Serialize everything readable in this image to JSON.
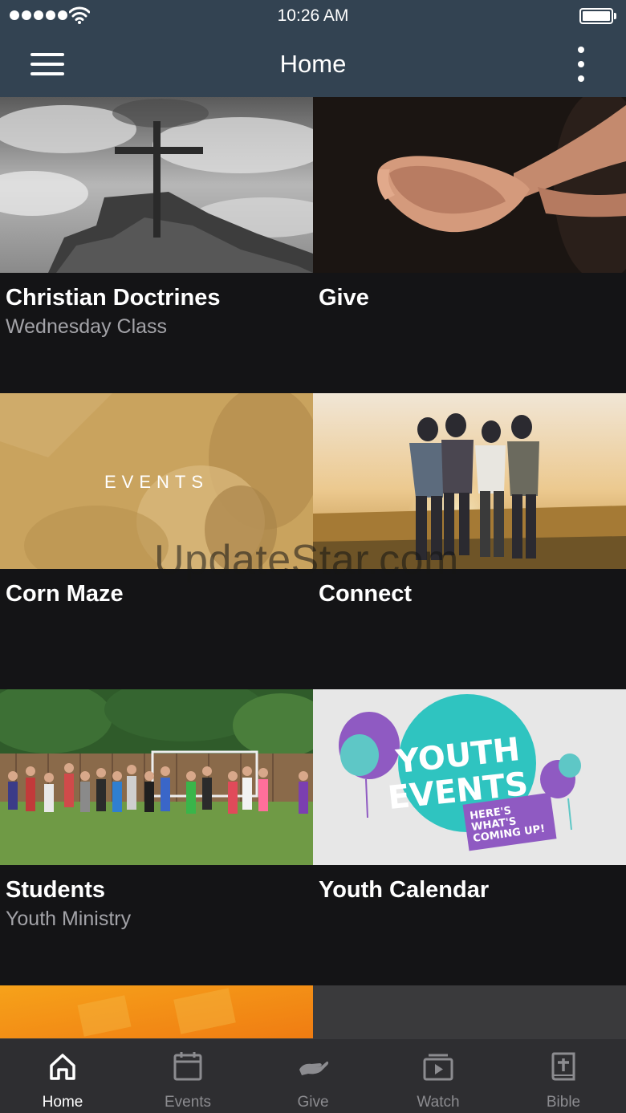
{
  "status_bar": {
    "time": "10:26 AM",
    "signal_icon": "signal-dots-icon",
    "wifi_icon": "wifi-icon",
    "battery_icon": "battery-icon"
  },
  "nav": {
    "title": "Home",
    "menu_icon": "hamburger-menu-icon",
    "more_icon": "more-vertical-icon"
  },
  "tiles": [
    {
      "title": "Christian Doctrines",
      "subtitle": "Wednesday Class",
      "image": "cross-on-rocks-photo"
    },
    {
      "title": "Give",
      "subtitle": "",
      "image": "open-hands-photo"
    },
    {
      "title": "Corn Maze",
      "subtitle": "",
      "image": "events-banner-photo",
      "image_text": "EVENTS"
    },
    {
      "title": "Connect",
      "subtitle": "",
      "image": "friends-sunset-photo"
    },
    {
      "title": "Students",
      "subtitle": "Youth Ministry",
      "image": "students-group-photo"
    },
    {
      "title": "Youth Calendar",
      "subtitle": "",
      "image": "youth-events-graphic",
      "image_lines": [
        "YOUTH",
        "EVENTS",
        "HERE'S",
        "WHAT'S",
        "COMING UP!"
      ]
    }
  ],
  "watermark": "UpdateStar.com",
  "tabs": [
    {
      "label": "Home",
      "icon": "home-icon",
      "active": true
    },
    {
      "label": "Events",
      "icon": "calendar-icon",
      "active": false
    },
    {
      "label": "Give",
      "icon": "give-hand-icon",
      "active": false
    },
    {
      "label": "Watch",
      "icon": "video-icon",
      "active": false
    },
    {
      "label": "Bible",
      "icon": "bible-icon",
      "active": false
    }
  ],
  "colors": {
    "nav_bg": "#334352",
    "page_bg": "#141416",
    "tab_bar_bg": "#2e2e31",
    "tab_active": "#ffffff",
    "tab_inactive": "#8c8c90",
    "subtitle": "#a3a3a8"
  }
}
